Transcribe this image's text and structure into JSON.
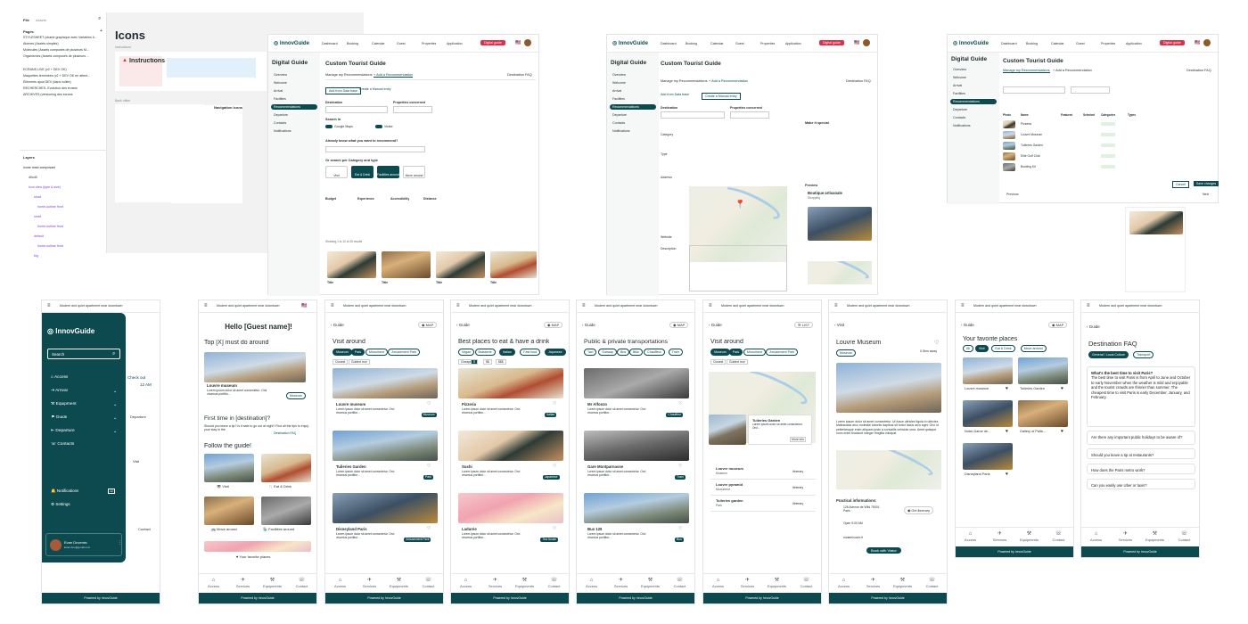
{
  "figma": {
    "file_label": "File",
    "assets_label": "Assets",
    "pages_header": "Pages",
    "pages": [
      "STYLESHEET (charte graphique avec Variables li...",
      "Atomes (Assets simples)",
      "Molécules (Assets composés de plusieurs M...",
      "Organismes (Assets composés de plusieurs ...",
      "ECRANS LIVE (v2 + DEV OK)",
      "Maquettes terminées (v2 + DEV OK en attent...",
      "Éléments ajout DEV (dans voilée)",
      "RECHERCHES- Evolution des écrans",
      "ARCHIVES (versioning des écrans"
    ],
    "layers_header": "Layers",
    "layers": [
      "Icone main composant",
      "40x40",
      "Icon view (type & size)",
      "small",
      "home-outline front",
      "small",
      "home-outline front",
      "default",
      "home-outline front",
      "big"
    ],
    "canvas_title": "Icons",
    "canvas_sub": "Instructions",
    "instr_title": "Instructions",
    "nav_icons_title": "Navigation Icons",
    "back_office": "Back office"
  },
  "desktop": {
    "brand": "InnovGuide",
    "nav": [
      "Dashboard",
      "Booking",
      "Calendar",
      "Guest",
      "Properties",
      "Application"
    ],
    "cta": "Digital guide",
    "sidebar_title": "Digital Guide",
    "sidebar_items": [
      "Overview",
      "Welcome",
      "Arrival",
      "Facilities",
      "Recommendations",
      "Departure",
      "Contacts",
      "Notifications"
    ],
    "page_title": "Custom Tourist Guide",
    "tab_manage": "Manage my Recommendations",
    "tab_add": "+ Add a Recommendation",
    "tab_faq": "Destination FAQ",
    "btn_add_db": "Add from Data base",
    "btn_add_manual": "Create a Manual entry",
    "destination": "Destination",
    "properties": "Properties concerned",
    "search_in": "Search in",
    "google_maps": "Google Maps",
    "visitor": "Visitor",
    "already_know": "Already know what you want to recommend?",
    "search_by_cat": "Or search per Category and type",
    "cats": [
      "Visit",
      "Eat & Drink",
      "Facilities around",
      "Move around"
    ],
    "budget": "Budget",
    "experience": "Experience",
    "accessibility": "Accessibility",
    "distance": "Distance",
    "results": "Showing 1 to 10 of 45 results",
    "cards": [
      "Title",
      "Title",
      "Title",
      "Title"
    ],
    "address": "Address",
    "category": "Category",
    "type": "Type",
    "website": "Website",
    "description": "Description",
    "make_it_special": "Make it special",
    "preview": "Preview",
    "shop_name": "Boutique artisanale",
    "shop_sub": "Shopping",
    "table_headers": [
      "Photo",
      "Name",
      "Featured",
      "Selected",
      "Categories",
      "Types"
    ],
    "table_rows": [
      "Pizzeria",
      "Louvre Museum",
      "Tuileries Garden",
      "Elite Golf Club",
      "Bowling Kit"
    ],
    "cancel": "Cancel",
    "save": "Save changes",
    "next": "Next",
    "previous": "Previous"
  },
  "mobile": {
    "address_bar": "Modern and quiet apartment near downtown",
    "tabs": [
      "Access",
      "Services",
      "Equipments",
      "Contact"
    ],
    "powered": "Powered by InnovGuide",
    "menu": {
      "search": "Search",
      "items": [
        "Access",
        "Arrival",
        "Equipment",
        "Guide",
        "Departure",
        "Contacts"
      ],
      "notifications": "Notifications",
      "notif_count": "12",
      "settings": "Settings",
      "user": "Evan Duventru",
      "email": "Evan.duv@gmail.com",
      "peek_departure": "Departure",
      "peek_visit": "Visit",
      "peek_checkout": "Check out",
      "peek_time": "12 AM",
      "peek_contact": "Contact"
    },
    "home": {
      "hello": "Hello [Guest name]!",
      "top": "Top [X] must do around",
      "card_title": "Louvre museum",
      "card_text": "Lorem ipsum dolor sit amet consectetur. Orci vivamus porttito...",
      "museum_pill": "Museum",
      "first_time": "First time in [destination]?",
      "first_text": "Should you leave a tip? Is it safe to go out at night? Find all the tips to enjoy your stay in the",
      "faq_link": "Destination FAQ",
      "follow": "Follow the guide!",
      "tiles": [
        "Visit",
        "Eat & Drink",
        "Move around",
        "Facilities around"
      ],
      "fav": "Your favorite places"
    },
    "visit": {
      "back": "Guide",
      "map": "MAP",
      "title": "Visit around",
      "chips": [
        "Museum",
        "Park",
        "Monument",
        "Amusement Park"
      ],
      "sort": [
        "Closest",
        "Guided tour"
      ],
      "items": [
        {
          "name": "Louvre museum",
          "text": "Lorem ipsum dolor sit amet consectetur. Orci vivamus porttitor...",
          "tag": "Museum"
        },
        {
          "name": "Tuileries Garden",
          "text": "Lorem ipsum dolor sit amet consectetur. Orci vivamus porttitor...",
          "tag": "Park"
        },
        {
          "name": "Disneyland Paris",
          "text": "Lorem ipsum dolor sit amet consectetur. Orci vivamus porttitor...",
          "tag": "Amusement Park"
        }
      ]
    },
    "eat": {
      "title": "Best places to eat & have a drink",
      "chips": [
        "Vegan",
        "Brasserie",
        "Italian",
        "Fast food",
        "Japanese"
      ],
      "sort": [
        "Cheapest",
        "$",
        "$$",
        "$$$"
      ],
      "items": [
        {
          "name": "Pizzeria",
          "text": "Lorem ipsum dolor sit amet consectetur. Orci vivamus porttitor...",
          "tag": "Italian"
        },
        {
          "name": "Sushi",
          "text": "Lorem ipsum dolor sit amet consectetur. Orci vivamus porttitor...",
          "tag": "Japanese"
        },
        {
          "name": "Ladurée",
          "text": "Lorem ipsum dolor sit amet consectetur. Orci vivamus porttitor...",
          "tag": "Tea house"
        }
      ]
    },
    "transport": {
      "title": "Public & private transportations",
      "chips": [
        "Taxi",
        "Subway",
        "Bus",
        "Bike",
        "Chauffeur",
        "Train"
      ],
      "items": [
        {
          "name": "Mr Alfonzo",
          "text": "Lorem ipsum dolor sit amet consectetur. Orci vivamus porttitor...",
          "tag": "Chauffeur"
        },
        {
          "name": "Gare Montparnasse",
          "text": "Lorem ipsum dolor sit amet consectetur. Orci vivamus porttitor...",
          "tag": "Train"
        },
        {
          "name": "Bus 128",
          "text": "Lorem ipsum dolor sit amet consectetur. Orci vivamus porttitor...",
          "tag": "Bus"
        }
      ]
    },
    "visitmap": {
      "list": "LIST",
      "chips": [
        "Museum",
        "Park",
        "Monument",
        "Amusement Park"
      ],
      "popup_title": "Tuileries Garden",
      "popup_text": "Lorem ipsum dolor sit amet consectetur. Orci...",
      "more": "More info",
      "rows": [
        {
          "name": "Louvre museum",
          "tag": "Museum"
        },
        {
          "name": "Louvre pyramid",
          "tag": "Monument"
        },
        {
          "name": "Tuileries garden",
          "tag": "Park"
        }
      ],
      "itinerary": "Itinerary"
    },
    "detail": {
      "back": "Visit",
      "title": "Louvre Museum",
      "tag": "Museum",
      "distance": "0.5km away",
      "text": "Lorem ipsum dolor sit amet consectetur. Ut fusce ultricies ligula in ultricies. Malesuada arcu molestie lobortis dapibus sit tortor lacus arcu eget. Orci id pellentesque enim aliquam justo a convallis vehicula urna. Amet quisque nunc enim tincidunt integer fringilla volutpat.",
      "practical": "Practical informations:",
      "addr": "126 Avenue de Wild 75001 Paris",
      "gps": "Get itinerary",
      "hours": "Open 9:00 AM",
      "web": "museelouvre.fr",
      "book": "Book with Viator"
    },
    "fav": {
      "title": "Your favorite places",
      "chips": [
        "All",
        "Visit",
        "Eat & Drink",
        "Move around"
      ],
      "items": [
        "Louvre museum",
        "Tuileries Garden",
        "Notre-Dame de...",
        "Gallery of Palla...",
        "Disneyland Paris"
      ]
    },
    "faq": {
      "title": "Destination FAQ",
      "chips": [
        "General / Local Culture",
        "Transport"
      ],
      "q1": "What's the best time to visit Paris?",
      "a1": "The best time to visit Paris is from April to June and October to early November when the weather is mild and enjoyable and the tourist crowds are thinner than summer. The cheapest time to visit Paris is early December, January, and February.",
      "q2": "Are there any important public holidays to be aware of?",
      "q3": "Should you leave a tip at restaurants?",
      "q4": "How does the Paris metro work?",
      "q5": "Can you easily use Uber or taxis?"
    }
  }
}
